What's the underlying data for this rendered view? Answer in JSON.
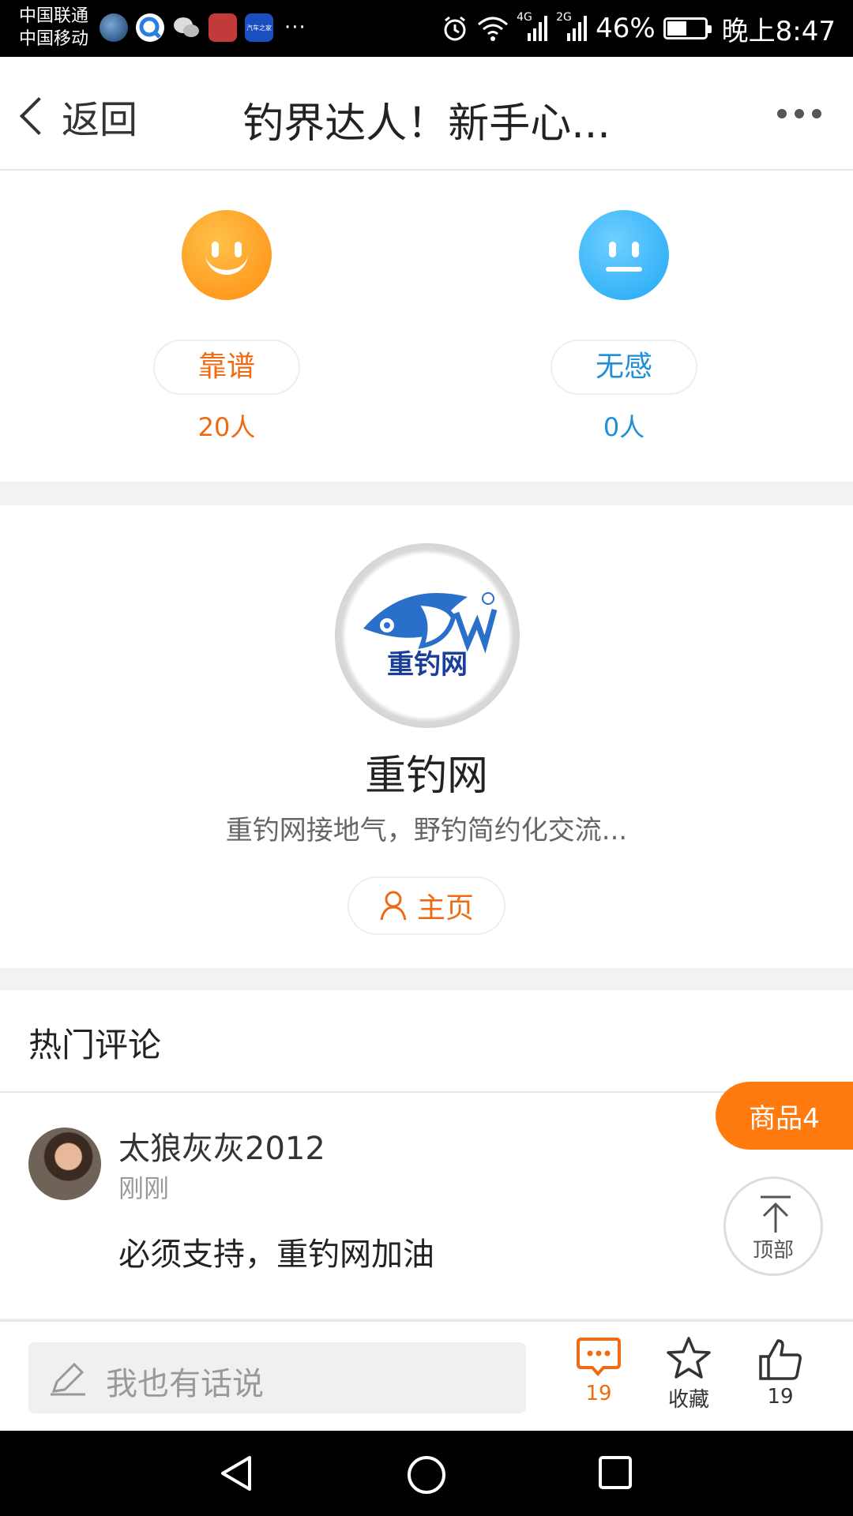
{
  "status_bar": {
    "carrier_1": "中国联通",
    "carrier_2": "中国移动",
    "overflow": "···",
    "net_4g": "4G",
    "net_2g": "2G",
    "battery": "46%",
    "time": "晚上8:47"
  },
  "nav": {
    "back_label": "返回",
    "title": "钓界达人！新手心...",
    "more_icon": "more-dots-icon"
  },
  "rating": {
    "positive": {
      "label": "靠谱",
      "count": "20人",
      "color": "#ef6a12",
      "icon": "smile-face-icon"
    },
    "neutral": {
      "label": "无感",
      "count": "0人",
      "color": "#1e8fd8",
      "icon": "neutral-face-icon"
    }
  },
  "author": {
    "logo_text": "重钓网",
    "name": "重钓网",
    "description": "重钓网接地气，野钓简约化交流...",
    "home_label": "主页"
  },
  "comments": {
    "section_title": "热门评论",
    "items": [
      {
        "user": "太狼灰灰2012",
        "time": "刚刚",
        "text": "必须支持，重钓网加油"
      }
    ]
  },
  "floating": {
    "goods_label": "商品4",
    "top_label": "顶部"
  },
  "action_bar": {
    "input_placeholder": "我也有话说",
    "comment_count": "19",
    "favorite_label": "收藏",
    "like_count": "19"
  },
  "colors": {
    "accent": "#ff7b0f",
    "orange_text": "#ef6a12",
    "blue_text": "#1e8fd8"
  }
}
